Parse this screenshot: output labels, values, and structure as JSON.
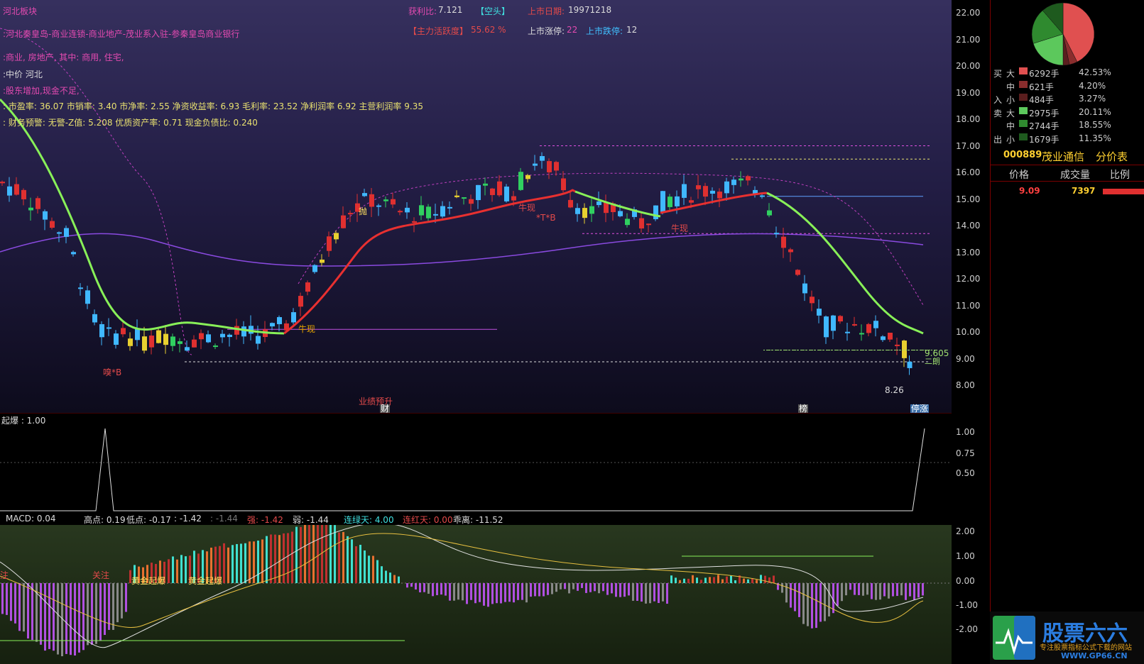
{
  "header": {
    "sector": "河北板块",
    "concept": ":河北秦皇岛-商业连锁-商业地产-茂业系入驻-参秦皇岛商业银行",
    "business": ":商业, 房地产, 其中: 商用, 住宅,",
    "region": ":中价 河北",
    "shareholder": ":股东增加,现金不足,",
    "valuation": ": 市盈率: 36.07 市销率: 3.40 市净率: 2.55 净资收益率: 6.93 毛利率: 23.52 净利润率 6.92 主营利润率 9.35",
    "risk": ": 财务预警: 无警-Z值: 5.208 优质资产率: 0.71 现金负债比: 0.240",
    "profit_ratio_label": "获利比:",
    "profit_ratio_value": "7.121",
    "trend_tag": "【空头】",
    "listing_date_label": "上市日期:",
    "listing_date_value": "19971218",
    "activity_label": "【主力活跃度】",
    "activity_value": "55.62 %",
    "limit_up_label": "上市涨停:",
    "limit_up_value": "22",
    "limit_down_label": "上市跌停:",
    "limit_down_value": "12"
  },
  "price_axis": [
    "22.00",
    "21.00",
    "20.00",
    "19.00",
    "18.00",
    "17.00",
    "16.00",
    "15.00",
    "14.00",
    "13.00",
    "12.00",
    "11.00",
    "10.00",
    "9.00",
    "8.00"
  ],
  "annotations": {
    "sell_mark": "抛",
    "bull_1": "牛现",
    "bull_2": "牛现",
    "bull_3": "牛现",
    "tb_1": "*T*B",
    "tb_2": "嗅*B",
    "performance": "业绩预升",
    "finance": "财",
    "bang": "榜",
    "limit_up_tag": "停涨",
    "low_value": "8.26",
    "level_value": "9.605",
    "level_tag": "二朗"
  },
  "indicator": {
    "name": "起爆 : 1.00",
    "axis": [
      "1.00",
      "0.75",
      "0.50"
    ]
  },
  "macd": {
    "label": "MACD: 0.04",
    "high": "高点: 0.19",
    "low": "低点: -0.17",
    "v1": ": -1.42",
    "v2": ": -1.44",
    "strong": "强: -1.42",
    "weak": "弱: -1.44",
    "green_days": "连绿天: 4.00",
    "red_days": "连红天: 0.00",
    "deviation": "乖离: -11.52",
    "axis": [
      "2.00",
      "1.00",
      "0.00",
      "-1.00",
      "-2.00"
    ],
    "tag_attention_1": "注",
    "tag_attention_2": "关注",
    "tag_gold_1": "黄金起爆",
    "tag_gold_2": "黄金起爆"
  },
  "right": {
    "stock_code": "000889",
    "stock_name": "茂业通信",
    "view": "分价表",
    "col_price": "价格",
    "col_volume": "成交量",
    "col_ratio": "比例",
    "price_row": {
      "price": "9.09",
      "volume": "7397"
    },
    "buy_label": "买入",
    "sell_label": "卖出",
    "flows": [
      {
        "side": "买",
        "size": "大",
        "vol": "6292手",
        "pct": "42.53%",
        "color": "#e05050"
      },
      {
        "side": "",
        "size": "中",
        "vol": "621手",
        "pct": "4.20%",
        "color": "#8a2d2d"
      },
      {
        "side": "入",
        "size": "小",
        "vol": "484手",
        "pct": "3.27%",
        "color": "#5a1e1e"
      },
      {
        "side": "卖",
        "size": "大",
        "vol": "2975手",
        "pct": "20.11%",
        "color": "#5cc85c"
      },
      {
        "side": "",
        "size": "中",
        "vol": "2744手",
        "pct": "18.55%",
        "color": "#2f8a2f"
      },
      {
        "side": "出",
        "size": "小",
        "vol": "1679手",
        "pct": "11.35%",
        "color": "#1e5a1e"
      }
    ],
    "pie": [
      42.53,
      4.2,
      3.27,
      20.11,
      18.55,
      11.35
    ],
    "logo_text": "股票六六",
    "logo_sub": "专注股票指标公式下载的网站",
    "logo_url": "WWW.GP66.CN"
  }
}
